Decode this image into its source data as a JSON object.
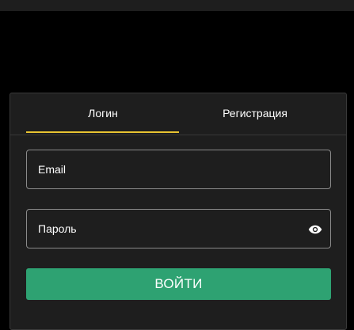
{
  "tabs": {
    "login_label": "Логин",
    "register_label": "Регистрация",
    "active": "login"
  },
  "form": {
    "email": {
      "placeholder": "Email",
      "value": ""
    },
    "password": {
      "placeholder": "Пароль",
      "value": ""
    },
    "submit_label": "ВОЙТИ"
  },
  "icons": {
    "password_toggle": "eye-icon"
  },
  "colors": {
    "page_background": "#000000",
    "card_background": "#1e1e1e",
    "accent_tab_underline": "#e9c431",
    "button_green": "#2ea272",
    "text": "#ffffff"
  }
}
